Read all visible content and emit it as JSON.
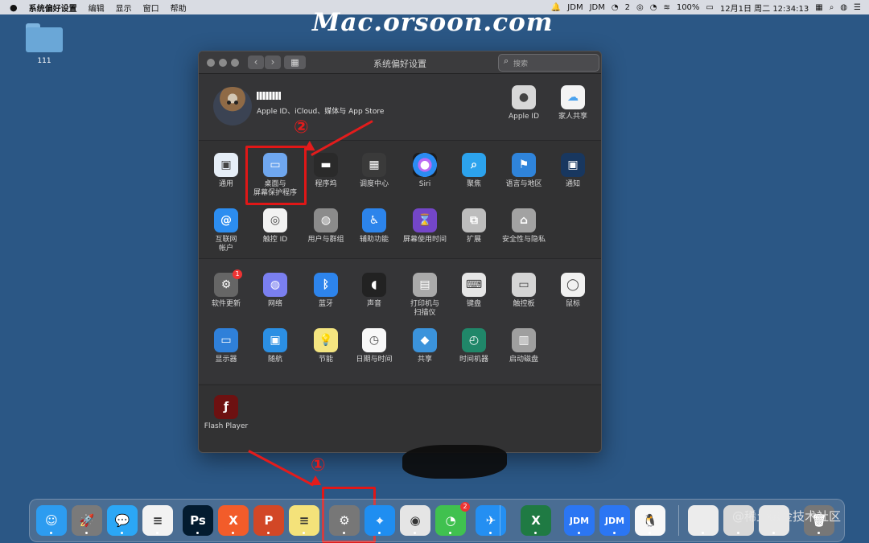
{
  "menubar": {
    "app": "系统偏好设置",
    "items": [
      "编辑",
      "显示",
      "窗口",
      "帮助"
    ],
    "right": {
      "jdm1": "JDM",
      "jdm2": "JDM",
      "wechat_count": "2",
      "battery": "100%",
      "datetime": "12月1日 周二 12:34:13"
    }
  },
  "watermark_top": "Mac.orsoon.com",
  "desktop": {
    "folder_label": "111"
  },
  "window": {
    "title": "系统偏好设置",
    "search_placeholder": "搜索",
    "user": {
      "subtitle": "Apple ID、iCloud、媒体与 App Store"
    },
    "top_right": [
      {
        "label": "Apple ID",
        "icon": "apple-logo"
      },
      {
        "label": "家人共享",
        "icon": "family-sharing"
      }
    ],
    "row1": [
      {
        "label": "通用",
        "icon": "general"
      },
      {
        "label": "桌面与\n屏幕保护程序",
        "icon": "desktop-screensaver"
      },
      {
        "label": "程序坞",
        "icon": "dock"
      },
      {
        "label": "调度中心",
        "icon": "mission-control"
      },
      {
        "label": "Siri",
        "icon": "siri"
      },
      {
        "label": "聚焦",
        "icon": "spotlight"
      },
      {
        "label": "语言与地区",
        "icon": "language-region"
      },
      {
        "label": "通知",
        "icon": "notifications"
      }
    ],
    "row2": [
      {
        "label": "互联网\n帐户",
        "icon": "internet-accounts"
      },
      {
        "label": "触控 ID",
        "icon": "touch-id"
      },
      {
        "label": "用户与群组",
        "icon": "users-groups"
      },
      {
        "label": "辅助功能",
        "icon": "accessibility"
      },
      {
        "label": "屏幕使用时间",
        "icon": "screen-time"
      },
      {
        "label": "扩展",
        "icon": "extensions"
      },
      {
        "label": "安全性与隐私",
        "icon": "security-privacy"
      }
    ],
    "row3": [
      {
        "label": "软件更新",
        "icon": "software-update",
        "badge": "1"
      },
      {
        "label": "网络",
        "icon": "network"
      },
      {
        "label": "蓝牙",
        "icon": "bluetooth"
      },
      {
        "label": "声音",
        "icon": "sound"
      },
      {
        "label": "打印机与\n扫描仪",
        "icon": "printer"
      },
      {
        "label": "键盘",
        "icon": "keyboard"
      },
      {
        "label": "触控板",
        "icon": "trackpad"
      },
      {
        "label": "鼠标",
        "icon": "mouse"
      }
    ],
    "row4": [
      {
        "label": "显示器",
        "icon": "display"
      },
      {
        "label": "随航",
        "icon": "sidecar"
      },
      {
        "label": "节能",
        "icon": "energy-saver"
      },
      {
        "label": "日期与时间",
        "icon": "date-time"
      },
      {
        "label": "共享",
        "icon": "sharing"
      },
      {
        "label": "时间机器",
        "icon": "time-machine"
      },
      {
        "label": "启动磁盘",
        "icon": "startup-disk"
      }
    ],
    "other": [
      {
        "label": "Flash Player",
        "icon": "flash-player"
      }
    ]
  },
  "annotations": {
    "one": "①",
    "two": "②"
  },
  "dock": [
    {
      "name": "finder",
      "text": "☺",
      "color": "#2d9cf0"
    },
    {
      "name": "launchpad",
      "text": "🚀",
      "color": "#7a7a7a"
    },
    {
      "name": "messages",
      "text": "💬",
      "color": "#2ba7f6"
    },
    {
      "name": "reminders",
      "text": "≡",
      "color": "#f2f2f2"
    },
    {
      "name": "photoshop",
      "text": "Ps",
      "color": "#031b2f"
    },
    {
      "name": "xmind",
      "text": "X",
      "color": "#f25c2a"
    },
    {
      "name": "powerpoint",
      "text": "P",
      "color": "#d24726"
    },
    {
      "name": "notes",
      "text": "≡",
      "color": "#f4e27a"
    },
    {
      "name": "system-preferences",
      "text": "⚙",
      "color": "#777"
    },
    {
      "name": "safari",
      "text": "⌖",
      "color": "#1f8ef1"
    },
    {
      "name": "chrome",
      "text": "◉",
      "color": "#e5e5e5"
    },
    {
      "name": "wechat",
      "text": "◔",
      "color": "#40c14f",
      "badge": "2"
    },
    {
      "name": "app-blue",
      "text": "✈",
      "color": "#248ff2"
    },
    {
      "name": "excel",
      "text": "X",
      "color": "#1f7a43"
    },
    {
      "name": "jdm-a",
      "text": "JDM",
      "color": "#2b76f3"
    },
    {
      "name": "jdm-b",
      "text": "JDM",
      "color": "#2b76f3"
    },
    {
      "name": "qq",
      "text": "🐧",
      "color": "#f7f7f7"
    },
    {
      "name": "thumb1",
      "text": "",
      "color": "#ececec"
    },
    {
      "name": "thumb2",
      "text": "",
      "color": "#d8d8d8"
    },
    {
      "name": "thumb3",
      "text": "",
      "color": "#e7e7e7"
    },
    {
      "name": "trash",
      "text": "🗑",
      "color": "#777"
    }
  ],
  "watermark_bottom": "@稀土掘金技术社区"
}
